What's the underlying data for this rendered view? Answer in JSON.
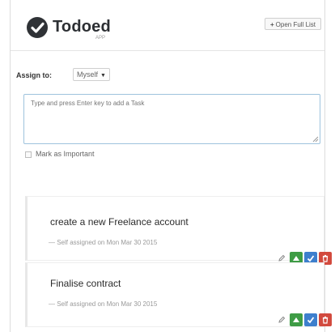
{
  "brand": {
    "name": "Todoed",
    "tagline": "APP",
    "open_full_list": "Open Full List"
  },
  "assign": {
    "label": "Assign to:",
    "selected": "Myself"
  },
  "task_input": {
    "placeholder": "Type and press Enter key to add a Task"
  },
  "important": {
    "label": "Mark as Important"
  },
  "tasks": [
    {
      "title": "create a new Freelance account",
      "meta": "— Self assigned on Mon Mar 30 2015"
    },
    {
      "title": "Finalise contract",
      "meta": "— Self assigned on Mon Mar 30 2015"
    }
  ],
  "icons": {
    "edit": "edit-icon",
    "up": "arrow-up-icon",
    "done": "check-icon",
    "delete": "trash-icon"
  },
  "colors": {
    "green": "#3e9c45",
    "blue": "#3d7fcd",
    "red": "#d24a3e",
    "input_border": "#9ec3dd"
  }
}
